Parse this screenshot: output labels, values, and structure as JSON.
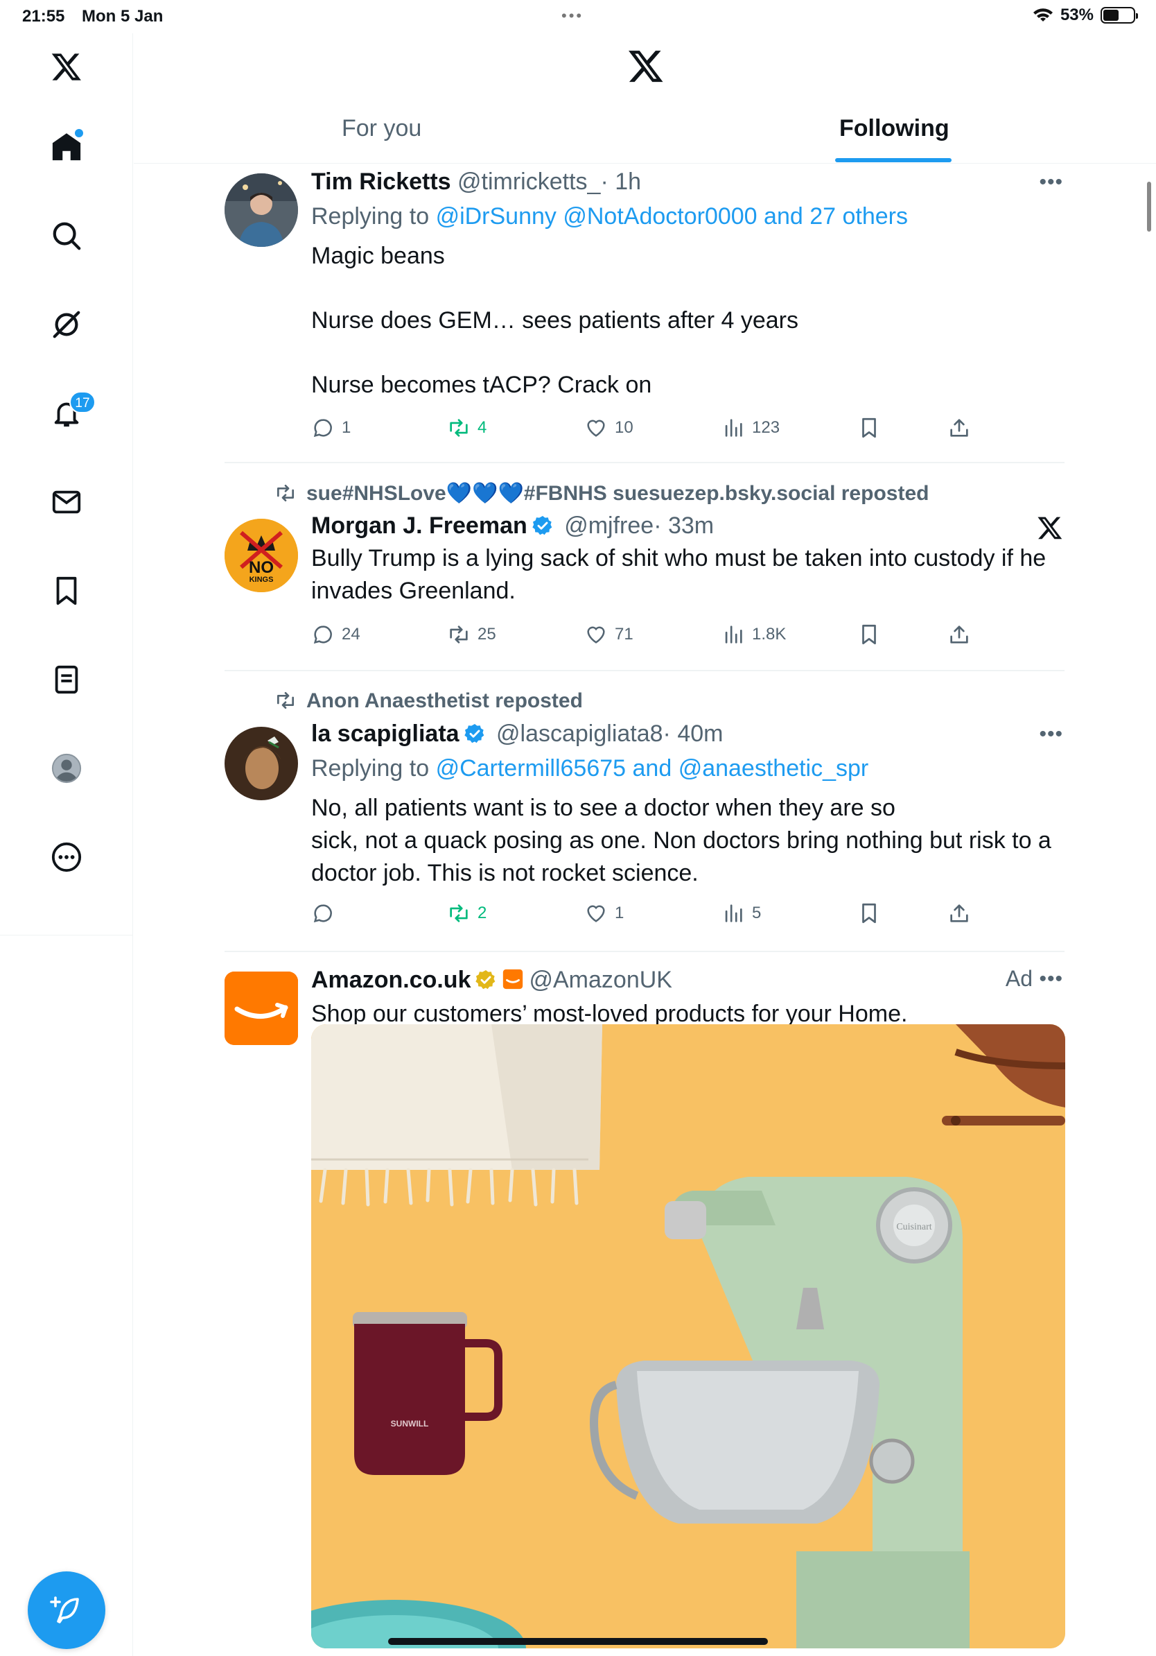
{
  "status_bar": {
    "time": "21:55",
    "date": "Mon 5 Jan",
    "battery": "53%",
    "battery_level": 0.53
  },
  "sidebar": {
    "items": [
      {
        "icon": "x-logo"
      },
      {
        "icon": "home-icon"
      },
      {
        "icon": "search-icon"
      },
      {
        "icon": "grok-icon"
      },
      {
        "icon": "bell-icon",
        "badge": "17"
      },
      {
        "icon": "mail-icon"
      },
      {
        "icon": "bookmark-icon"
      },
      {
        "icon": "lists-icon"
      },
      {
        "icon": "profile-icon"
      },
      {
        "icon": "more-icon"
      }
    ],
    "compose_icon": "compose-icon"
  },
  "header": {
    "tabs": [
      {
        "label": "For you"
      },
      {
        "label": "Following",
        "active": true
      }
    ]
  },
  "colors": {
    "accent": "#1d9bf0",
    "repost_green": "#00ba7c",
    "muted": "#536471",
    "amazon": "#ff7900"
  },
  "tweets": [
    {
      "name": "Tim Ricketts",
      "handle": "@timricketts_",
      "time": "· 1h",
      "replying_prefix": "Replying to",
      "replying_to": "@iDrSunny @NotAdoctor0000 and 27 others",
      "text": [
        "Magic beans",
        "Nurse does GEM… sees patients after 4 years",
        "Nurse becomes tACP? Crack on"
      ],
      "reply_count": "1",
      "repost_count": "4",
      "like_count": "10",
      "view_count": "123"
    },
    {
      "reposted_by": "sue#NHSLove💙💙💙#FBNHS suesuezep.bsky.social reposted",
      "name": "Morgan J. Freeman",
      "handle": "@mjfree",
      "time": "· 33m",
      "text": [
        "Bully Trump is a lying sack of shit who must be taken into custody if he",
        "invades Greenland."
      ],
      "avatar_text": [
        "NO",
        "KINGS"
      ],
      "reply_count": "24",
      "repost_count": "25",
      "like_count": "71",
      "view_count": "1.8K"
    },
    {
      "reposted_by": "Anon Anaesthetist reposted",
      "name": "la scapigliata",
      "handle": "@lascapigliata8",
      "time": "· 40m",
      "replying_prefix": "Replying to",
      "replying_to": "@Cartermill65675 and @anaesthetic_spr",
      "text": [
        "No, all patients want is to see a doctor when they are so",
        "sick, not a quack posing as one. Non doctors bring nothing but risk to a",
        "doctor job. This is not rocket science."
      ],
      "reply_count": "",
      "repost_count": "2",
      "like_count": "1",
      "view_count": "5"
    },
    {
      "name": "Amazon.co.uk",
      "handle": "@AmazonUK",
      "ad_label": "Ad",
      "text": [
        "Shop our customers’ most-loved products for your Home."
      ],
      "mug_brand": "SUNWILL",
      "mixer_brand": "Cuisinart"
    }
  ]
}
